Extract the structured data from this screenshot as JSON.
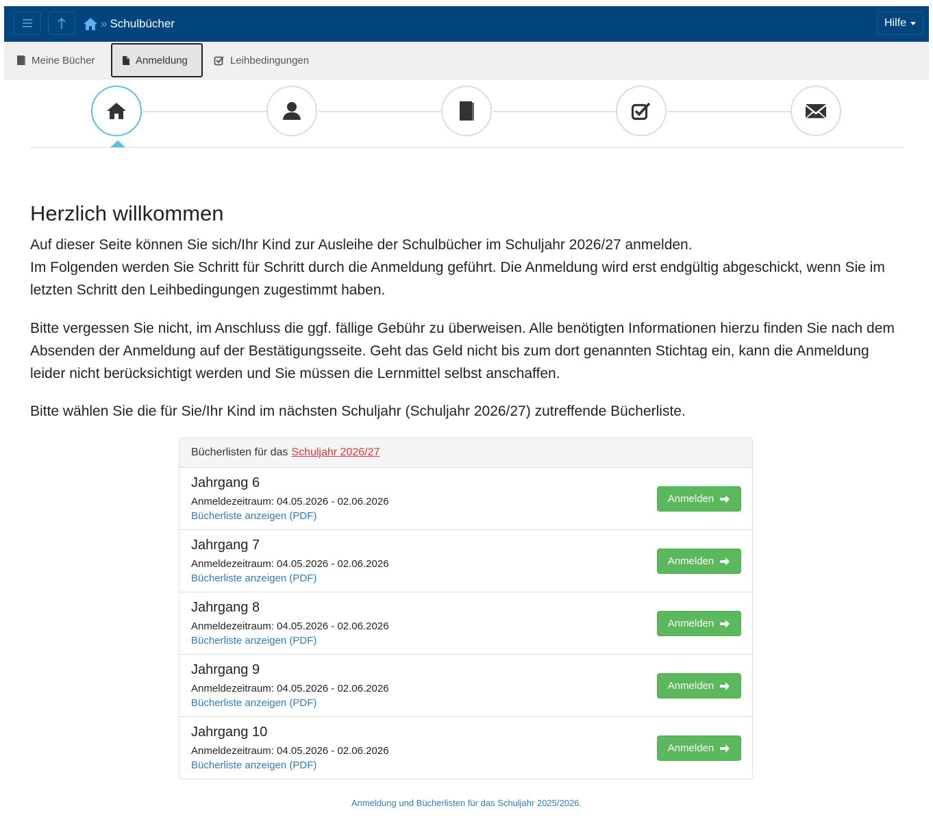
{
  "navbar": {
    "title": "Schulbücher",
    "separator": "»",
    "help_label": "Hilfe",
    "menu_icon": "hamburger-icon",
    "up_icon": "arrow-up-icon",
    "home_icon": "home-icon"
  },
  "tabs": [
    {
      "label": "Meine Bücher",
      "icon": "book-icon"
    },
    {
      "label": "Anmeldung",
      "icon": "file-icon",
      "active": true
    },
    {
      "label": "Leihbedingungen",
      "icon": "checkbox-icon"
    }
  ],
  "wizard": {
    "steps": [
      "home-icon",
      "user-icon",
      "book-icon",
      "checkbox-icon",
      "envelope-icon"
    ],
    "active_step": 1
  },
  "content": {
    "heading": "Herzlich willkommen",
    "paragraph1_line1": "Auf dieser Seite können Sie sich/Ihr Kind zur Ausleihe der Schulbücher im Schuljahr 2026/27 anmelden.",
    "paragraph1_line2": "Im Folgenden werden Sie Schritt für Schritt durch die Anmeldung geführt. Die Anmeldung wird erst endgültig abgeschickt, wenn Sie im letzten Schritt den Leihbedingungen zugestimmt haben.",
    "paragraph2": "Bitte vergessen Sie nicht, im Anschluss die ggf. fällige Gebühr zu überweisen. Alle benötigten Informationen hierzu finden Sie nach dem Absenden der Anmeldung auf der Bestätigungsseite. Geht das Geld nicht bis zum dort genannten Stichtag ein, kann die Anmeldung leider nicht berücksichtigt werden und Sie müssen die Lernmittel selbst anschaffen.",
    "paragraph3": "Bitte wählen Sie die für Sie/Ihr Kind im nächsten Schuljahr (Schuljahr 2026/27) zutreffende Bücherliste."
  },
  "booklists": {
    "header_prefix": "Bücherlisten für das",
    "header_link": "Schuljahr 2026/27",
    "rows": [
      {
        "grade": "Jahrgang 6",
        "period": "Anmeldezeitraum: 04.05.2026 - 02.06.2026",
        "pdf_link": "Bücherliste anzeigen (PDF)",
        "button": "Anmelden"
      },
      {
        "grade": "Jahrgang 7",
        "period": "Anmeldezeitraum: 04.05.2026 - 02.06.2026",
        "pdf_link": "Bücherliste anzeigen (PDF)",
        "button": "Anmelden"
      },
      {
        "grade": "Jahrgang 8",
        "period": "Anmeldezeitraum: 04.05.2026 - 02.06.2026",
        "pdf_link": "Bücherliste anzeigen (PDF)",
        "button": "Anmelden"
      },
      {
        "grade": "Jahrgang 9",
        "period": "Anmeldezeitraum: 04.05.2026 - 02.06.2026",
        "pdf_link": "Bücherliste anzeigen (PDF)",
        "button": "Anmelden"
      },
      {
        "grade": "Jahrgang 10",
        "period": "Anmeldezeitraum: 04.05.2026 - 02.06.2026",
        "pdf_link": "Bücherliste anzeigen (PDF)",
        "button": "Anmelden"
      }
    ]
  },
  "footer": {
    "text": "Anmeldung und Bücherlisten für das Schuljahr 2025/2026."
  },
  "colors": {
    "navbar": "#00457e",
    "accent": "#5bc0de",
    "button": "#5cb85c",
    "link": "#337ab7",
    "link_highlight": "#d9363e"
  }
}
